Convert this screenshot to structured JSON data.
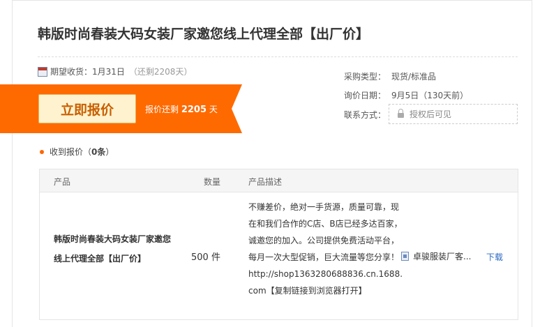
{
  "title": "韩版时尚春装大码女装厂家邀您线上代理全部【出厂价】",
  "expect": {
    "label": "期望收货：1月31日",
    "remaining": "（还剩2208天）"
  },
  "quote": {
    "button": "立即报价",
    "remain_prefix": "报价还剩",
    "remain_days": "2205",
    "remain_unit": "天"
  },
  "colors": {
    "banner": "#ff6a00",
    "button_text": "#c85e00",
    "link": "#2a6bc1"
  },
  "info": {
    "purchase_type_label": "采购类型：",
    "purchase_type": "现货/标准品",
    "inquiry_date_label": "询价日期：",
    "inquiry_date": "9月5日（130天前）",
    "contact_label": "联系方式：",
    "contact_value": "授权后可见"
  },
  "received": {
    "label": "收到报价（",
    "count": "0条",
    "close": "）"
  },
  "table": {
    "headers": {
      "product": "产品",
      "quantity": "数量",
      "description": "产品描述"
    },
    "row": {
      "product": "韩版时尚春装大码女装厂家邀您线上代理全部【出厂价】",
      "quantity": "500 件",
      "description": "不赚差价，绝对一手货源，质量可靠，现在和我们合作的C店、B店已经多达百家，诚邀您的加入。公司提供免费活动平台，每月一次大型促销，巨大流量等您分享！http://shop1363280688836.cn.1688.com【复制链接到浏览器打开】",
      "attachment": "卓骏服装厂客...",
      "download": "下载"
    }
  }
}
